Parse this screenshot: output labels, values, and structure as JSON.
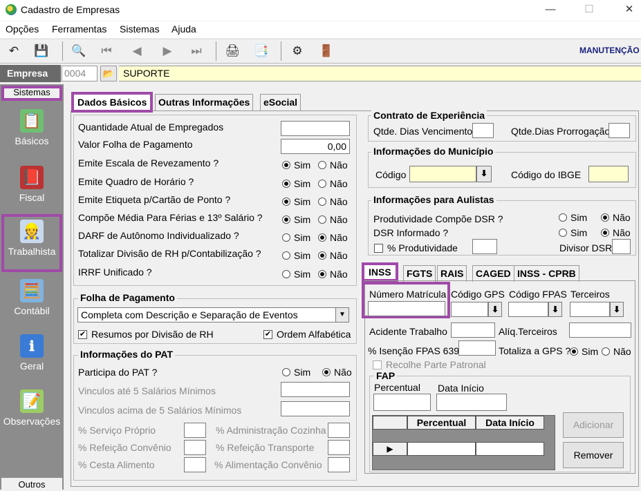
{
  "window": {
    "title": "Cadastro de Empresas",
    "min": "—",
    "max": "☐",
    "close": "✕"
  },
  "menu": [
    "Opções",
    "Ferramentas",
    "Sistemas",
    "Ajuda"
  ],
  "toolbar": {
    "mode": "MANUTENÇÃO"
  },
  "empresa": {
    "label": "Empresa",
    "code": "0004",
    "name": "SUPORTE"
  },
  "sidebar": {
    "header": "Sistemas",
    "items": [
      "Básicos",
      "Fiscal",
      "Trabalhista",
      "Contábil",
      "Geral",
      "Observações"
    ],
    "footer": "Outros"
  },
  "tabs": [
    "Dados Básicos",
    "Outras Informações",
    "eSocial"
  ],
  "dados": {
    "qtd_empregados": "Quantidade Atual de Empregados",
    "valor_folha": "Valor Folha de Pagamento",
    "valor_folha_value": "0,00",
    "questions": [
      {
        "label": "Emite Escala de Revezamento ?",
        "selected": "Sim"
      },
      {
        "label": "Emite Quadro de Horário ?",
        "selected": "Sim"
      },
      {
        "label": "Emite Etiqueta p/Cartão de Ponto ?",
        "selected": "Sim"
      },
      {
        "label": "Compõe Média Para Férias e 13º Salário ?",
        "selected": "Sim"
      },
      {
        "label": "DARF de Autônomo Individualizado ?",
        "selected": "Não"
      },
      {
        "label": "Totalizar Divisão de RH p/Contabilização ?",
        "selected": "Não"
      },
      {
        "label": "IRRF Unificado ?",
        "selected": "Não"
      }
    ],
    "sim": "Sim",
    "nao": "Não"
  },
  "folha": {
    "title": "Folha de Pagamento",
    "select_value": "Completa com Descrição e Separação de Eventos",
    "resumos": "Resumos por Divisão de RH",
    "ordem": "Ordem Alfabética"
  },
  "pat": {
    "title": "Informações do PAT",
    "participa": "Participa do PAT ?",
    "participa_selected": "Não",
    "vinc_ate": "Vinculos até 5 Salários Mínimos",
    "vinc_acima": "Vinculos acima de 5 Salários Mínimos",
    "servico": "% Serviço Próprio",
    "admin": "% Administração Cozinha",
    "refeicao_conv": "% Refeição Convênio",
    "refeicao_transp": "% Refeição Transporte",
    "cesta": "% Cesta Alimento",
    "alim_conv": "% Alimentação Convênio"
  },
  "contrato": {
    "title": "Contrato de Experiência",
    "venc": "Qtde. Dias Vencimento",
    "prorr": "Qtde.Dias Prorrogação"
  },
  "municipio": {
    "title": "Informações do Município",
    "codigo": "Código",
    "ibge": "Código do IBGE"
  },
  "aulistas": {
    "title": "Informações para Aulistas",
    "prod": "Produtividade Compõe DSR ?",
    "prod_selected": "Não",
    "dsr": "DSR Informado ?",
    "dsr_selected": "Não",
    "perc_prod": "% Produtividade",
    "divisor": "Divisor DSR"
  },
  "subtabs": [
    "INSS",
    "FGTS",
    "RAIS",
    "CAGED",
    "INSS - CPRB"
  ],
  "inss": {
    "matricula": "Número Matrícula",
    "gps": "Código GPS",
    "fpas": "Código FPAS",
    "terceiros": "Terceiros",
    "acidente": "Acidente Trabalho",
    "aliq_terc": "Alíq.Terceiros",
    "isencao": "% Isenção FPAS 639",
    "totaliza": "Totaliza a GPS ?",
    "totaliza_selected": "Sim",
    "recolhe": "Recolhe Parte Patronal"
  },
  "fap": {
    "title": "FAP",
    "percentual": "Percentual",
    "data_inicio": "Data Início",
    "columns": [
      "Percentual",
      "Data Início"
    ],
    "adicionar": "Adicionar",
    "remover": "Remover"
  }
}
